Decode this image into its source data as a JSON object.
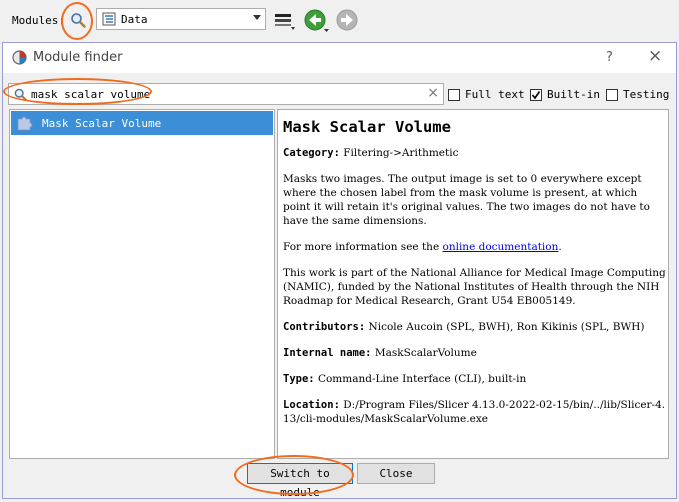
{
  "toolbar": {
    "modules_label": "Modules:",
    "selected_module": "Data"
  },
  "dialog": {
    "title": "Module finder",
    "help": "?",
    "close_x": "×",
    "search_value": "mask scalar volume",
    "options": {
      "full_text": "Full text",
      "built_in": "Built-in",
      "testing": "Testing"
    },
    "results": [
      {
        "label": "Mask Scalar Volume"
      }
    ],
    "description": {
      "title": "Mask Scalar Volume",
      "category_label": "Category:",
      "category": "Filtering->Arithmetic",
      "para1": "Masks two images. The output image is set to 0 everywhere except where the chosen label from the mask volume is present, at which point it will retain it's original values. The two images do not have to have the same dimensions.",
      "more_info_prefix": "For more information see the ",
      "more_info_link": "online documentation",
      "more_info_suffix": ".",
      "ack": "This work is part of the National Alliance for Medical Image Computing (NAMIC), funded by the National Institutes of Health through the NIH Roadmap for Medical Research, Grant U54 EB005149.",
      "contributors_label": "Contributors:",
      "contributors": "Nicole Aucoin (SPL, BWH), Ron Kikinis (SPL, BWH)",
      "internal_name_label": "Internal name:",
      "internal_name": "MaskScalarVolume",
      "type_label": "Type:",
      "type": "Command-Line Interface (CLI), built-in",
      "location_label": "Location:",
      "location": "D:/Program Files/Slicer 4.13.0-2022-02-15/bin/../lib/Slicer-4.13/cli-modules/MaskScalarVolume.exe"
    },
    "buttons": {
      "switch": "Switch to module",
      "close": "Close"
    }
  },
  "colors": {
    "selection": "#3c8fd6",
    "annotation": "#f26b1d",
    "link": "#0000ee"
  }
}
